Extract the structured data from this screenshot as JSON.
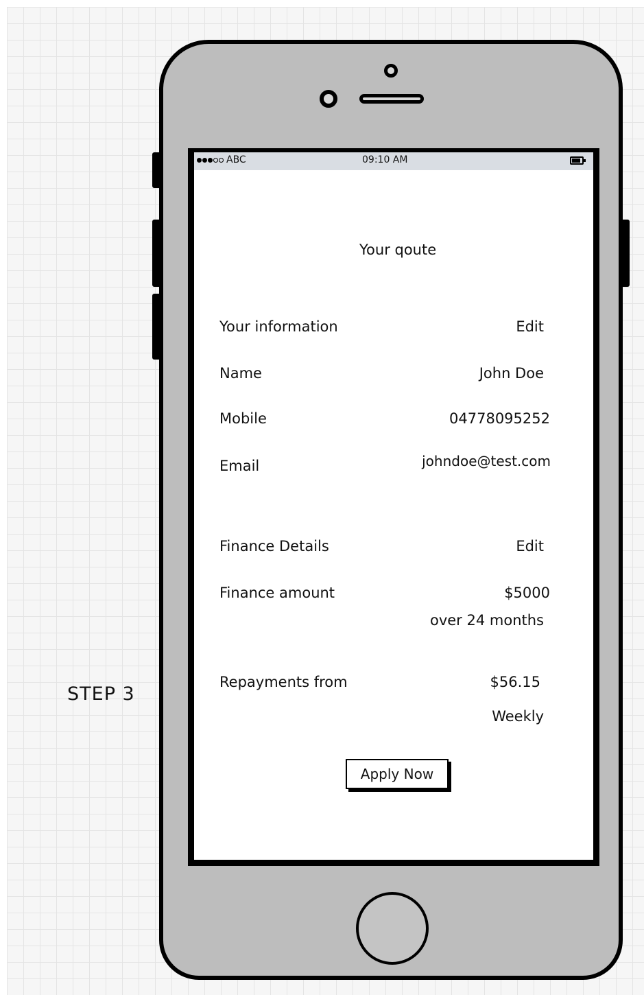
{
  "annotation": {
    "step_label": "STEP 3"
  },
  "status_bar": {
    "carrier": "ABC",
    "time": "09:10 AM",
    "signal_icon": "signal-dots-icon",
    "battery_icon": "battery-icon"
  },
  "screen": {
    "title": "Your qoute",
    "your_information": {
      "heading": "Your information",
      "edit_label": "Edit",
      "name_label": "Name",
      "name_value": "John Doe",
      "mobile_label": "Mobile",
      "mobile_value": "04778095252",
      "email_label": "Email",
      "email_value": "johndoe@test.com"
    },
    "finance_details": {
      "heading": "Finance Details",
      "edit_label": "Edit",
      "amount_label": "Finance amount",
      "amount_value": "$5000",
      "term": "over 24 months",
      "repayments_label": "Repayments from",
      "repayments_value": "$56.15",
      "repayments_frequency": "Weekly"
    },
    "apply_button_label": "Apply Now"
  }
}
